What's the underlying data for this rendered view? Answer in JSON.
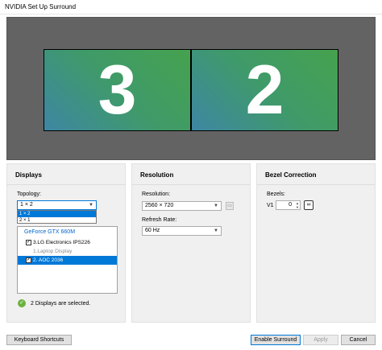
{
  "window": {
    "title": "NVIDIA Set Up Surround"
  },
  "preview": {
    "monitors": [
      {
        "number": "3"
      },
      {
        "number": "2"
      }
    ]
  },
  "displays": {
    "title": "Displays",
    "topology_label": "Topology:",
    "topology_value": "1 × 2",
    "topology_options": [
      "1 × 2",
      "2 × 1"
    ],
    "gpu_name": "GeForce GTX 660M",
    "items": [
      {
        "label": "3.LG Electronics IPS226",
        "checked": true
      },
      {
        "label": "1.Laptop Display",
        "checked": false
      },
      {
        "label": "2. AOC 2036",
        "checked": true
      }
    ],
    "status": "2 Displays are selected."
  },
  "resolution": {
    "title": "Resolution",
    "resolution_label": "Resolution:",
    "resolution_value": "2560 × 720",
    "refresh_label": "Refresh Rate:",
    "refresh_value": "60 Hz"
  },
  "bezel": {
    "title": "Bezel Correction",
    "bezels_label": "Bezels:",
    "v1_label": "V1",
    "v1_value": "0"
  },
  "footer": {
    "keyboard_shortcuts": "Keyboard Shortcuts",
    "enable_surround": "Enable Surround",
    "apply": "Apply",
    "cancel": "Cancel"
  }
}
